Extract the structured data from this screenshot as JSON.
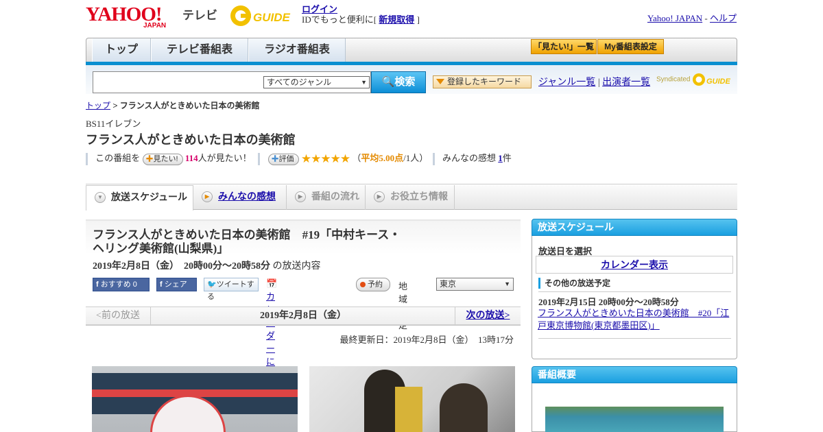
{
  "header": {
    "logo_text": "YAHOO!",
    "logo_sub": "JAPAN",
    "section_label": "テレビ",
    "gguide_text": "G GUIDE",
    "login_label": "ログイン",
    "login_desc_prefix": "IDでもっと便利に[",
    "register_label": "新規取得",
    "login_desc_suffix": "]",
    "yahoo_japan_link": "Yahoo! JAPAN",
    "help_link": "ヘルプ",
    "separator": " - "
  },
  "nav": {
    "tabs": [
      "トップ",
      "テレビ番組表",
      "ラジオ番組表"
    ],
    "btn_mitai_list": "「見たい!」一覧",
    "btn_my_schedule": "My番組表設定"
  },
  "search": {
    "input_value": "",
    "genre_value": "すべてのジャンル",
    "search_button": "検索",
    "keyword_button": "登録したキーワード",
    "genre_list_link": "ジャンル一覧",
    "performer_list_link": "出演者一覧",
    "link_sep": "|",
    "syndicated": "Syndicated"
  },
  "breadcrumb": {
    "top": "トップ",
    "sep": ">",
    "current": "フランス人がときめいた日本の美術館"
  },
  "program": {
    "station": "BS11イレブン",
    "title": "フランス人がときめいた日本の美術館",
    "mitai_prefix": "この番組を",
    "mitai_button": "見たい!",
    "mitai_count": "114",
    "mitai_suffix": "人が見たい！",
    "rating_button": "評価",
    "rating_stars": 5,
    "rating_open": "（",
    "rating_avg": "平均5.00点",
    "rating_people": "/1人）",
    "impressions_prefix": "みんなの感想",
    "impressions_count": "1",
    "impressions_suffix": "件"
  },
  "tabs": {
    "schedule": "放送スケジュール",
    "impressions": "みんなの感想",
    "flow": "番組の流れ",
    "info": "お役立ち情報"
  },
  "episode": {
    "title": "フランス人がときめいた日本の美術館　#19「中村キース・ヘリング美術館(山梨県)」",
    "date": "2019年2月8日（金）　20時00分～20時58分",
    "date_suffix": "の放送内容",
    "fb_recommend": "おすすめ 0",
    "fb_share": "シェア",
    "tweet": "ツイートする",
    "calendar_add": "カレンダーに登録",
    "reserve": "予約",
    "region_label": "地域設定",
    "region_value": "東京"
  },
  "pager": {
    "prev": "<前の放送",
    "current": "2019年2月8日（金）",
    "next": "次の放送>"
  },
  "updated": "最終更新日：2019年2月8日（金）　13時17分",
  "sidebar": {
    "schedule_title": "放送スケジュール",
    "select_date": "放送日を選択",
    "calendar_button": "カレンダー表示",
    "other_label": "その他の放送予定",
    "other_date": "2019年2月15日  20時00分～20時58分",
    "other_link": "フランス人がときめいた日本の美術館　#20「江戸東京博物館(東京都墨田区)」",
    "overview_title": "番組概要"
  }
}
